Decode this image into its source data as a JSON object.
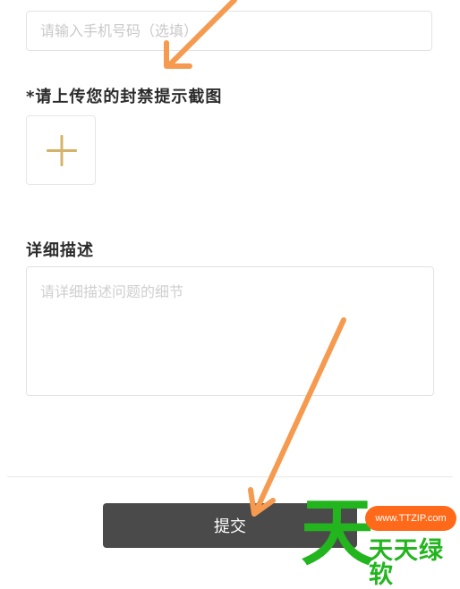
{
  "form": {
    "phone": {
      "placeholder": "请输入手机号码（选填）",
      "value": ""
    },
    "screenshot_label": "*请上传您的封禁提示截图",
    "upload_icon": "plus-icon",
    "detail_label": "详细描述",
    "detail_placeholder": "请详细描述问题的细节",
    "submit_label": "提交"
  },
  "watermark": {
    "big_char": "天",
    "url": "www.TTZIP.com",
    "name": "天天绿软"
  },
  "colors": {
    "plus_icon": "#d4b46a",
    "submit_bg": "#4a4a4a",
    "annotation_arrow": "#f59a4e",
    "watermark_green": "#22b51e",
    "watermark_orange": "#ff6a1a"
  }
}
